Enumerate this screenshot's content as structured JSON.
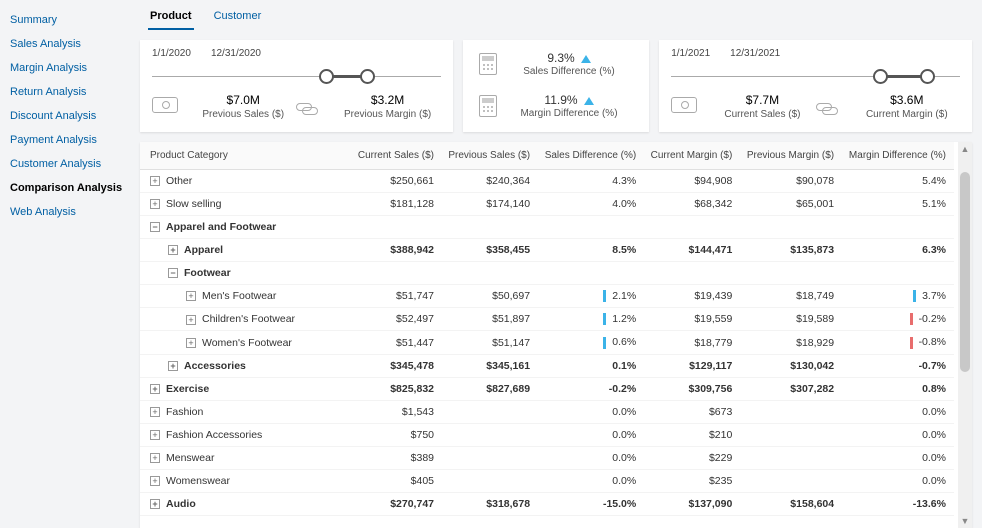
{
  "sidebar": {
    "items": [
      {
        "label": "Summary"
      },
      {
        "label": "Sales Analysis"
      },
      {
        "label": "Margin Analysis"
      },
      {
        "label": "Return Analysis"
      },
      {
        "label": "Discount Analysis"
      },
      {
        "label": "Payment Analysis"
      },
      {
        "label": "Customer Analysis"
      },
      {
        "label": "Comparison Analysis"
      },
      {
        "label": "Web Analysis"
      }
    ],
    "active": 7
  },
  "tabs": {
    "items": [
      {
        "label": "Product"
      },
      {
        "label": "Customer"
      }
    ],
    "active": 0
  },
  "prev": {
    "start": "1/1/2020",
    "end": "12/31/2020",
    "sales": "$7.0M",
    "sales_lbl": "Previous Sales ($)",
    "margin": "$3.2M",
    "margin_lbl": "Previous Margin ($)"
  },
  "diff": {
    "sales": "9.3%",
    "sales_lbl": "Sales Difference (%)",
    "margin": "11.9%",
    "margin_lbl": "Margin Difference (%)"
  },
  "curr": {
    "start": "1/1/2021",
    "end": "12/31/2021",
    "sales": "$7.7M",
    "sales_lbl": "Current Sales ($)",
    "margin": "$3.6M",
    "margin_lbl": "Current Margin ($)"
  },
  "table": {
    "cols": [
      "Product Category",
      "Current Sales ($)",
      "Previous Sales ($)",
      "Sales Difference (%)",
      "Current Margin ($)",
      "Previous Margin ($)",
      "Margin Difference (%)"
    ],
    "rows": [
      {
        "d": 1,
        "e": "+",
        "n": "Other",
        "c": [
          "$250,661",
          "$240,364",
          "4.3%",
          "$94,908",
          "$90,078",
          "5.4%"
        ]
      },
      {
        "d": 1,
        "e": "+",
        "n": "Slow selling",
        "c": [
          "$181,128",
          "$174,140",
          "4.0%",
          "$68,342",
          "$65,001",
          "5.1%"
        ]
      },
      {
        "d": 1,
        "e": "-",
        "n": "Apparel and Footwear",
        "c": [
          "",
          "",
          "",
          "",
          "",
          ""
        ],
        "bold": true
      },
      {
        "d": 2,
        "e": "+",
        "n": "Apparel",
        "c": [
          "$388,942",
          "$358,455",
          "8.5%",
          "$144,471",
          "$135,873",
          "6.3%"
        ],
        "bold": true
      },
      {
        "d": 2,
        "e": "-",
        "n": "Footwear",
        "c": [
          "",
          "",
          "",
          "",
          "",
          ""
        ],
        "bold": true
      },
      {
        "d": 3,
        "e": "+",
        "n": "Men's Footwear",
        "c": [
          "$51,747",
          "$50,697",
          "2.1%",
          "$19,439",
          "$18,749",
          "3.7%"
        ],
        "sb": "b",
        "mb": "b"
      },
      {
        "d": 3,
        "e": "+",
        "n": "Children's Footwear",
        "c": [
          "$52,497",
          "$51,897",
          "1.2%",
          "$19,559",
          "$19,589",
          "-0.2%"
        ],
        "sb": "b",
        "mb": "r"
      },
      {
        "d": 3,
        "e": "+",
        "n": "Women's Footwear",
        "c": [
          "$51,447",
          "$51,147",
          "0.6%",
          "$18,779",
          "$18,929",
          "-0.8%"
        ],
        "sb": "b",
        "mb": "r"
      },
      {
        "d": 2,
        "e": "+",
        "n": "Accessories",
        "c": [
          "$345,478",
          "$345,161",
          "0.1%",
          "$129,117",
          "$130,042",
          "-0.7%"
        ],
        "bold": true
      },
      {
        "d": 1,
        "e": "+",
        "n": "Exercise",
        "c": [
          "$825,832",
          "$827,689",
          "-0.2%",
          "$309,756",
          "$307,282",
          "0.8%"
        ],
        "bold": true
      },
      {
        "d": 1,
        "e": "+",
        "n": "Fashion",
        "c": [
          "$1,543",
          "",
          "0.0%",
          "$673",
          "",
          "0.0%"
        ]
      },
      {
        "d": 1,
        "e": "+",
        "n": "Fashion Accessories",
        "c": [
          "$750",
          "",
          "0.0%",
          "$210",
          "",
          "0.0%"
        ]
      },
      {
        "d": 1,
        "e": "+",
        "n": "Menswear",
        "c": [
          "$389",
          "",
          "0.0%",
          "$229",
          "",
          "0.0%"
        ]
      },
      {
        "d": 1,
        "e": "+",
        "n": "Womenswear",
        "c": [
          "$405",
          "",
          "0.0%",
          "$235",
          "",
          "0.0%"
        ]
      },
      {
        "d": 1,
        "e": "+",
        "n": "Audio",
        "c": [
          "$270,747",
          "$318,678",
          "-15.0%",
          "$137,090",
          "$158,604",
          "-13.6%"
        ],
        "bold": true
      }
    ]
  }
}
